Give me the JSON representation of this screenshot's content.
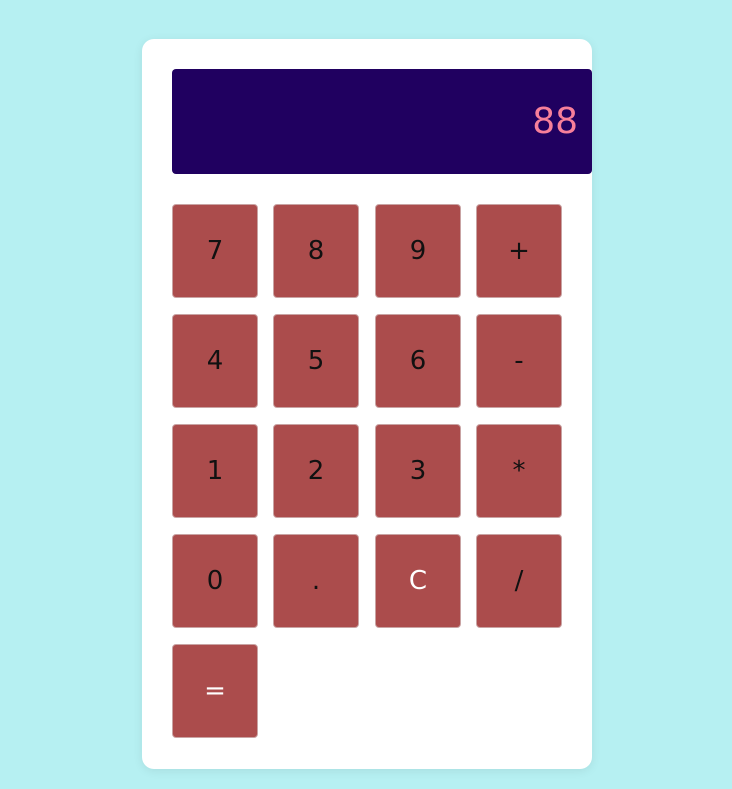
{
  "display": {
    "value": "88"
  },
  "keys": {
    "k7": "7",
    "k8": "8",
    "k9": "9",
    "plus": "+",
    "k4": "4",
    "k5": "5",
    "k6": "6",
    "minus": "-",
    "k1": "1",
    "k2": "2",
    "k3": "3",
    "multiply": "*",
    "k0": "0",
    "dot": ".",
    "clear": "C",
    "divide": "/",
    "equals": "="
  },
  "colors": {
    "page_background": "#b6f0f2",
    "display_background": "#200060",
    "display_text": "#f77f9a",
    "key_background": "#ab4c4c"
  }
}
